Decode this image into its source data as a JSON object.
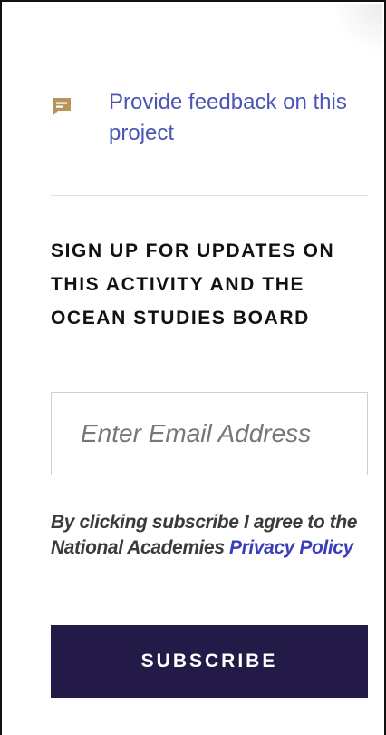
{
  "feedback": {
    "icon": "comment-icon",
    "icon_color": "#b8945a",
    "link_text": "Provide feedback on this project",
    "link_color": "#4a55b8"
  },
  "signup": {
    "heading": "SIGN UP FOR UPDATES ON THIS ACTIVITY AND THE OCEAN STUDIES BOARD",
    "email_placeholder": "Enter Email Address",
    "email_value": "",
    "agree_prefix": "By clicking subscribe I agree to the National Academies ",
    "privacy_link": "Privacy Policy",
    "subscribe_label": "SUBSCRIBE",
    "button_color": "#231a48"
  }
}
